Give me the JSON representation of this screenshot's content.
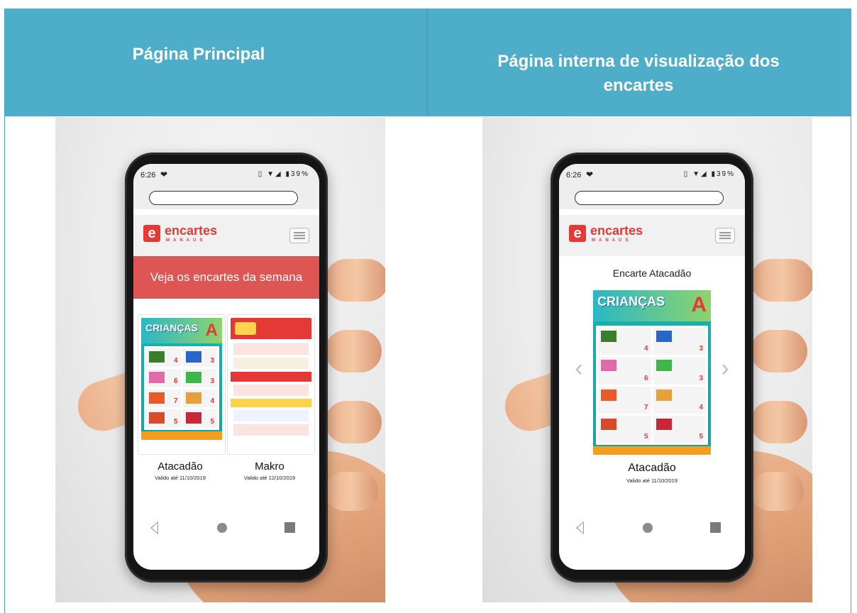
{
  "headers": {
    "left": "Página Principal",
    "right": "Página interna de visualização dos encartes"
  },
  "status": {
    "time": "6:26",
    "battery": "39%"
  },
  "brand": {
    "name": "encartes",
    "sub": "MANAUS",
    "letter": "e"
  },
  "home": {
    "banner": "Veja os encartes da semana",
    "cards": [
      {
        "title": "Atacadão",
        "valid": "Valido até 11/10/2019"
      },
      {
        "title": "Makro",
        "valid": "Valido até 12/10/2019"
      }
    ]
  },
  "detail": {
    "heading": "Encarte Atacadão",
    "title": "Atacadão",
    "valid": "Valido até 11/10/2019"
  },
  "flyer": {
    "headline": "CRIANÇAS",
    "logo": "A",
    "prices": [
      "4",
      "3",
      "6",
      "3",
      "7",
      "4",
      "5",
      "5"
    ]
  },
  "colors": {
    "header_band": "#4eadc8",
    "brand_red": "#e53935",
    "banner_red": "#de5654"
  }
}
